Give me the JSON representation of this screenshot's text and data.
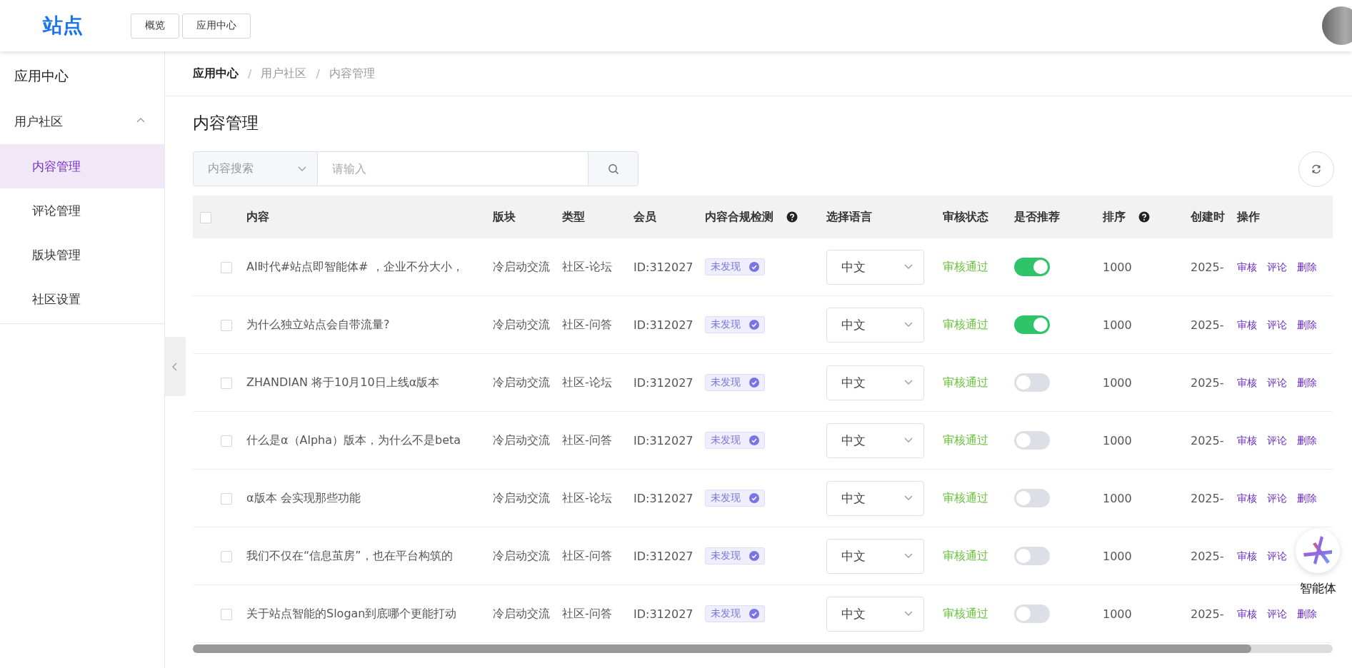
{
  "header": {
    "logo": "站点",
    "nav_buttons": [
      {
        "label": "概览"
      },
      {
        "label": "应用中心"
      }
    ]
  },
  "sidebar": {
    "title": "应用中心",
    "groups": [
      {
        "label": "用户社区",
        "expanded": true,
        "children": [
          {
            "label": "内容管理",
            "selected": true
          },
          {
            "label": "评论管理",
            "selected": false
          },
          {
            "label": "版块管理",
            "selected": false
          },
          {
            "label": "社区设置",
            "selected": false
          }
        ]
      }
    ]
  },
  "breadcrumb": [
    {
      "label": "应用中心"
    },
    {
      "separator": "/",
      "label": "用户社区"
    },
    {
      "separator": "/",
      "label": "内容管理"
    }
  ],
  "page_title": "内容管理",
  "search": {
    "category": "内容搜索",
    "placeholder": "请输入"
  },
  "table": {
    "select_all_checked": false,
    "columns": [
      {
        "label": "内容",
        "help": false
      },
      {
        "label": "版块",
        "help": false
      },
      {
        "label": "类型",
        "help": false
      },
      {
        "label": "会员",
        "help": false
      },
      {
        "label": "内容合规检测",
        "help": true
      },
      {
        "label": "选择语言",
        "help": false
      },
      {
        "label": "审核状态",
        "help": false
      },
      {
        "label": "是否推荐",
        "help": false
      },
      {
        "label": "排序",
        "help": true
      },
      {
        "label": "创建时",
        "help": false
      },
      {
        "label": "操作",
        "help": false
      }
    ],
    "rows": [
      {
        "checked": false,
        "content": "AI时代#站点即智能体# ，企业不分大小，",
        "section": "冷启动交流",
        "type": "社区-论坛",
        "member": "ID:312027",
        "compliance": "未发现",
        "language": "中文",
        "review_status": "审核通过",
        "recommended": true,
        "sort": "1000",
        "created": "2025-",
        "actions": [
          "审核",
          "评论",
          "删除"
        ]
      },
      {
        "checked": false,
        "content": "为什么独立站点会自带流量?",
        "section": "冷启动交流",
        "type": "社区-问答",
        "member": "ID:312027",
        "compliance": "未发现",
        "language": "中文",
        "review_status": "审核通过",
        "recommended": true,
        "sort": "1000",
        "created": "2025-",
        "actions": [
          "审核",
          "评论",
          "删除"
        ]
      },
      {
        "checked": false,
        "content": "ZHANDIAN 将于10月10日上线α版本",
        "section": "冷启动交流",
        "type": "社区-论坛",
        "member": "ID:312027",
        "compliance": "未发现",
        "language": "中文",
        "review_status": "审核通过",
        "recommended": false,
        "sort": "1000",
        "created": "2025-",
        "actions": [
          "审核",
          "评论",
          "删除"
        ]
      },
      {
        "checked": false,
        "content": "什么是α（Alpha）版本，为什么不是beta",
        "section": "冷启动交流",
        "type": "社区-问答",
        "member": "ID:312027",
        "compliance": "未发现",
        "language": "中文",
        "review_status": "审核通过",
        "recommended": false,
        "sort": "1000",
        "created": "2025-",
        "actions": [
          "审核",
          "评论",
          "删除"
        ]
      },
      {
        "checked": false,
        "content": "α版本 会实现那些功能",
        "section": "冷启动交流",
        "type": "社区-论坛",
        "member": "ID:312027",
        "compliance": "未发现",
        "language": "中文",
        "review_status": "审核通过",
        "recommended": false,
        "sort": "1000",
        "created": "2025-",
        "actions": [
          "审核",
          "评论",
          "删除"
        ]
      },
      {
        "checked": false,
        "content": "我们不仅在“信息茧房”，也在平台构筑的",
        "section": "冷启动交流",
        "type": "社区-问答",
        "member": "ID:312027",
        "compliance": "未发现",
        "language": "中文",
        "review_status": "审核通过",
        "recommended": false,
        "sort": "1000",
        "created": "2025-",
        "actions": [
          "审核",
          "评论"
        ]
      },
      {
        "checked": false,
        "content": "关于站点智能的Slogan到底哪个更能打动",
        "section": "冷启动交流",
        "type": "社区-问答",
        "member": "ID:312027",
        "compliance": "未发现",
        "language": "中文",
        "review_status": "审核通过",
        "recommended": false,
        "sort": "1000",
        "created": "2025-",
        "actions": [
          "审核",
          "评论",
          "删除"
        ]
      }
    ]
  },
  "assistant": {
    "label": "智能体"
  }
}
